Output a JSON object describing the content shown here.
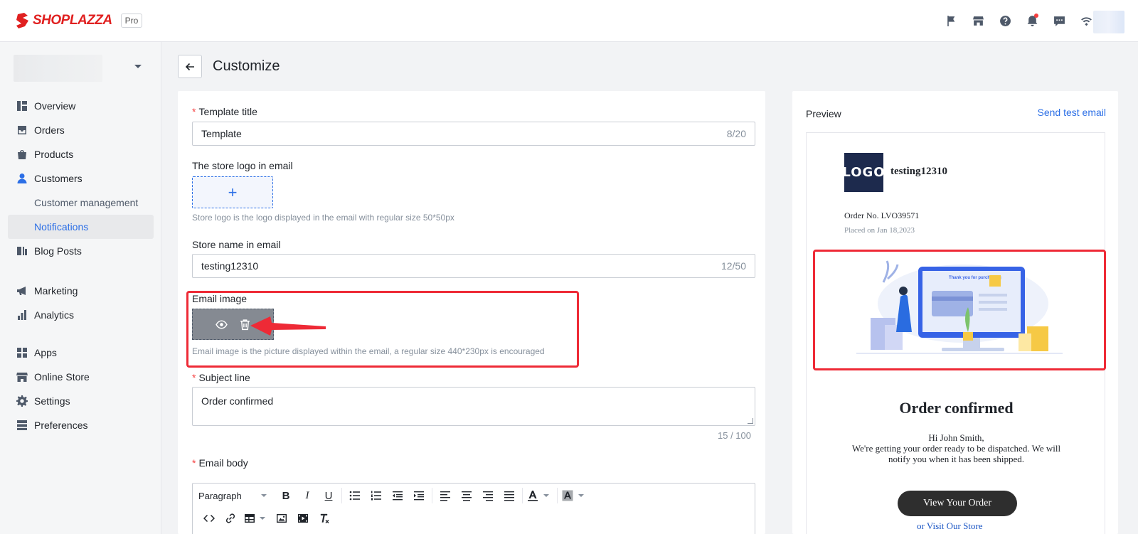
{
  "brand": {
    "name": "SHOPLAZZA",
    "plan": "Pro"
  },
  "topbar": {
    "icons": [
      "flag-icon",
      "store-icon",
      "help-icon",
      "bell-icon",
      "chat-icon",
      "wifi-icon"
    ]
  },
  "sidebar": {
    "items": [
      {
        "label": "Overview",
        "icon": "overview-icon"
      },
      {
        "label": "Orders",
        "icon": "orders-icon"
      },
      {
        "label": "Products",
        "icon": "products-icon"
      },
      {
        "label": "Customers",
        "icon": "customers-icon"
      },
      {
        "label": "Customer management"
      },
      {
        "label": "Notifications"
      },
      {
        "label": "Blog Posts",
        "icon": "blog-icon"
      },
      {
        "label": "Marketing",
        "icon": "marketing-icon"
      },
      {
        "label": "Analytics",
        "icon": "analytics-icon"
      },
      {
        "label": "Apps",
        "icon": "apps-icon"
      },
      {
        "label": "Online Store",
        "icon": "online-store-icon"
      },
      {
        "label": "Settings",
        "icon": "settings-icon"
      },
      {
        "label": "Preferences",
        "icon": "preferences-icon"
      }
    ]
  },
  "page": {
    "title": "Customize"
  },
  "form": {
    "template_title": {
      "label": "Template title",
      "value": "Template",
      "counter": "8/20"
    },
    "store_logo": {
      "label": "The store logo in email",
      "plus": "+",
      "help": "Store logo is the logo displayed in the email with regular size 50*50px"
    },
    "store_name": {
      "label": "Store name in email",
      "value": "testing12310",
      "counter": "12/50"
    },
    "email_image": {
      "label": "Email image",
      "help": "Email image is the picture displayed within the email, a regular size 440*230px is encouraged"
    },
    "subject": {
      "label": "Subject line",
      "value": "Order confirmed",
      "counter": "15 / 100"
    },
    "email_body": {
      "label": "Email body",
      "paragraph": "Paragraph"
    }
  },
  "preview": {
    "title": "Preview",
    "send_test": "Send test email",
    "logo_text": "LOGO",
    "store_name": "testing12310",
    "order_no": "Order No. LVO39571",
    "placed_on": "Placed on Jan 18,2023",
    "illustration_text": "Thank you for purchasing",
    "heading": "Order confirmed",
    "greeting": "Hi John Smith,",
    "message": "We're getting your order ready to be dispatched. We will notify you when it has been shipped.",
    "view_button": "View Your Order",
    "visit_link": "or Visit Our Store"
  },
  "colors": {
    "accent": "#2c6fe6",
    "brand": "#e02020",
    "highlight": "#ee2a36"
  }
}
